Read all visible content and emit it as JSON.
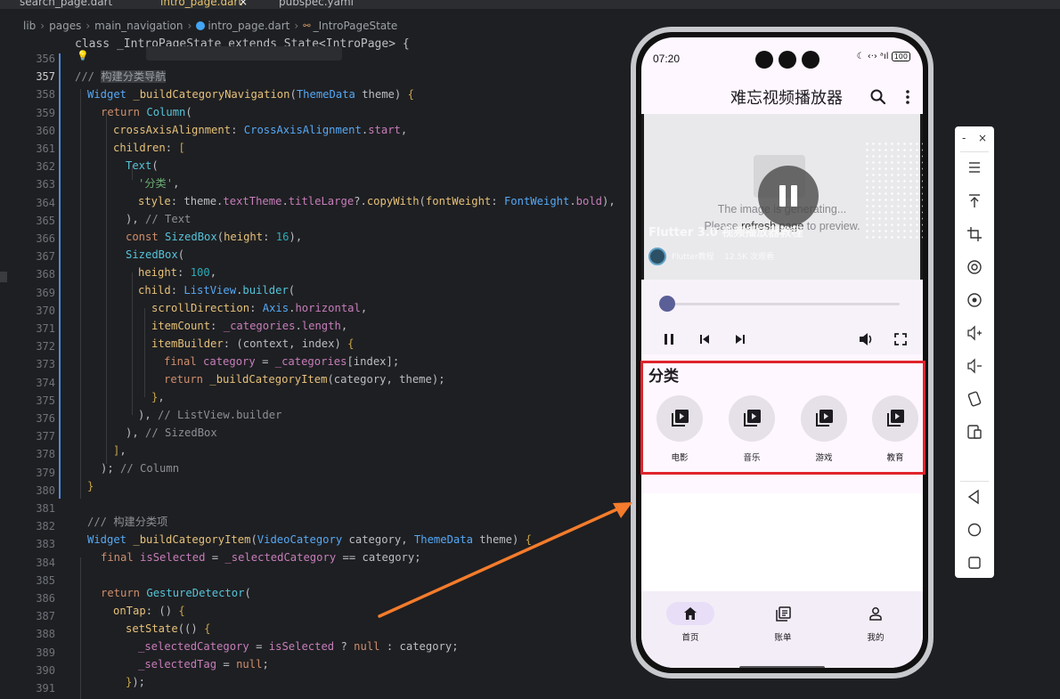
{
  "editor": {
    "tabs": [
      {
        "label": "search_page.dart",
        "active": false
      },
      {
        "label": "intro_page.dart",
        "active": true
      },
      {
        "label": "pubspec.yaml",
        "active": false
      }
    ],
    "tab_close": "×",
    "breadcrumb": [
      "lib",
      "pages",
      "main_navigation",
      "intro_page.dart",
      "_IntroPageState"
    ],
    "sticky_header": "class _IntroPageState extends State<IntroPage> {",
    "line_numbers": [
      "356",
      "357",
      "358",
      "359",
      "360",
      "361",
      "362",
      "363",
      "364",
      "365",
      "366",
      "367",
      "368",
      "369",
      "370",
      "371",
      "372",
      "373",
      "374",
      "375",
      "376",
      "377",
      "378",
      "379",
      "380",
      "381",
      "382",
      "383",
      "384",
      "385",
      "386",
      "387",
      "388",
      "389",
      "390",
      "391"
    ],
    "current_line": "357"
  },
  "phone": {
    "status": {
      "time": "07:20",
      "icons": "☾ ‹·› ᵃıl",
      "battery": "100"
    },
    "app_title": "难忘视频播放器",
    "video": {
      "placeholder_line1": "The image is generating...",
      "placeholder_line2_a": "Please ",
      "placeholder_line2_b": "refresh page",
      "placeholder_line2_c": " to preview.",
      "title": "Flutter 3.0 视频播放器教程",
      "channel": "Flutter教程",
      "views": "12.5K 次观看"
    },
    "player": {
      "progress": 0.0
    },
    "categories": {
      "title": "分类",
      "items": [
        {
          "label": "电影"
        },
        {
          "label": "音乐"
        },
        {
          "label": "游戏"
        },
        {
          "label": "教育"
        }
      ]
    },
    "nav": [
      {
        "label": "首页",
        "icon": "home-icon",
        "selected": true
      },
      {
        "label": "账单",
        "icon": "library-icon",
        "selected": false
      },
      {
        "label": "我的",
        "icon": "person-icon",
        "selected": false
      }
    ]
  },
  "toolbar": {
    "minimize": "-",
    "close": "×"
  },
  "colors": {
    "highlight": "#e0242d",
    "arrow": "#f47c2c",
    "accent": "#5b5f97"
  }
}
